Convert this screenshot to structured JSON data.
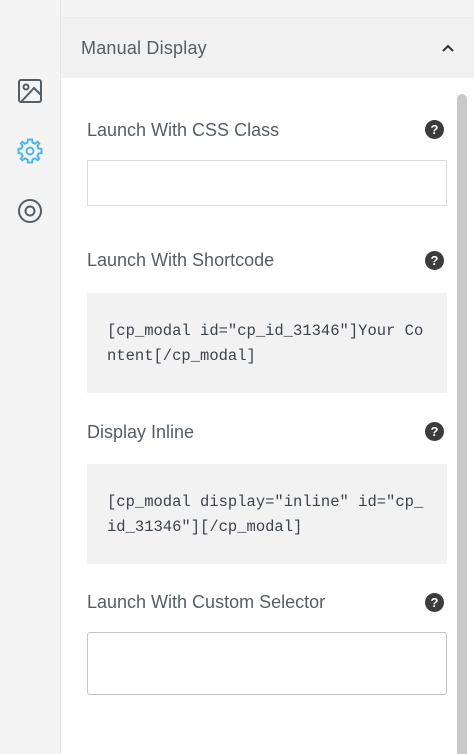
{
  "sidebar": {
    "items": [
      {
        "name": "design",
        "icon": "image-icon",
        "active": false
      },
      {
        "name": "settings",
        "icon": "gear-icon",
        "active": true
      },
      {
        "name": "target",
        "icon": "target-icon",
        "active": false
      }
    ],
    "active_color": "#4bb7e6",
    "inactive_color": "#555d66"
  },
  "section": {
    "title": "Manual Display",
    "expanded": true
  },
  "fields": {
    "css_class": {
      "label": "Launch With CSS Class",
      "value": "",
      "help": "?"
    },
    "shortcode": {
      "label": "Launch With Shortcode",
      "code": "[cp_modal id=\"cp_id_31346\"]Your Content[/cp_modal]",
      "help": "?"
    },
    "inline": {
      "label": "Display Inline",
      "code": "[cp_modal display=\"inline\" id=\"cp_id_31346\"][/cp_modal]",
      "help": "?"
    },
    "custom_selector": {
      "label": "Launch With Custom Selector",
      "value": "",
      "help": "?"
    }
  }
}
